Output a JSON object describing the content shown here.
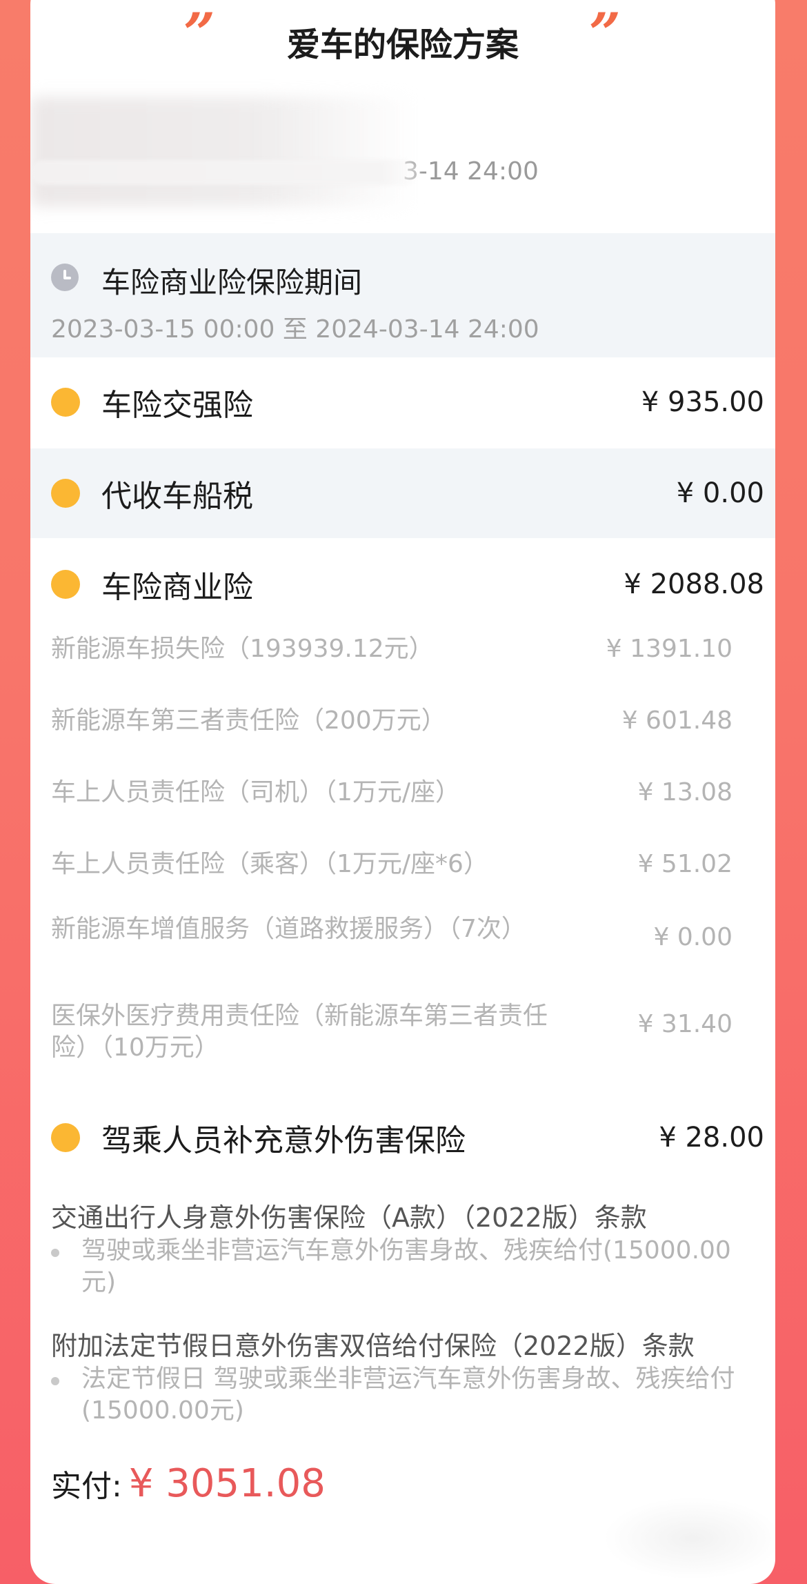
{
  "header": {
    "title": "爱车的保险方案",
    "quote_mark": "”"
  },
  "blurred": {
    "date_fragment": "3-14 24:00"
  },
  "period": {
    "label": "车险商业险保险期间",
    "dates": "2023-03-15 00:00 至 2024-03-14 24:00"
  },
  "rows": [
    {
      "label": "车险交强险",
      "price": "¥ 935.00"
    },
    {
      "label": "代收车船税",
      "price": "¥ 0.00"
    },
    {
      "label": "车险商业险",
      "price": "¥ 2088.08"
    }
  ],
  "commercial_items": [
    {
      "name": "新能源车损失险（193939.12元）",
      "amount": "¥ 1391.10"
    },
    {
      "name": "新能源车第三者责任险（200万元）",
      "amount": "¥ 601.48"
    },
    {
      "name": "车上人员责任险（司机）（1万元/座）",
      "amount": "¥ 13.08"
    },
    {
      "name": "车上人员责任险（乘客）（1万元/座*6）",
      "amount": "¥ 51.02"
    },
    {
      "name": "新能源车增值服务（道路救援服务）（7次）",
      "amount": "¥ 0.00"
    },
    {
      "name": "医保外医疗费用责任险（新能源车第三者责任险）（10万元）",
      "amount": "¥ 31.40"
    }
  ],
  "accident": {
    "label": "驾乘人员补充意外伤害保险",
    "price": "¥ 28.00"
  },
  "clauses": [
    {
      "title": "交通出行人身意外伤害保险（A款）（2022版）条款",
      "item": "驾驶或乘坐非营运汽车意外伤害身故、残疾给付(15000.00元)"
    },
    {
      "title": "附加法定节假日意外伤害双倍给付保险（2022版）条款",
      "item": "法定节假日 驾驶或乘坐非营运汽车意外伤害身故、残疾给付(15000.00元)"
    }
  ],
  "total": {
    "label": "实付:",
    "value": "¥ 3051.08"
  },
  "colors": {
    "accent": "#f26a46",
    "dot": "#fbb733",
    "total": "#e8595a",
    "gray_bg": "#f2f5f8"
  }
}
